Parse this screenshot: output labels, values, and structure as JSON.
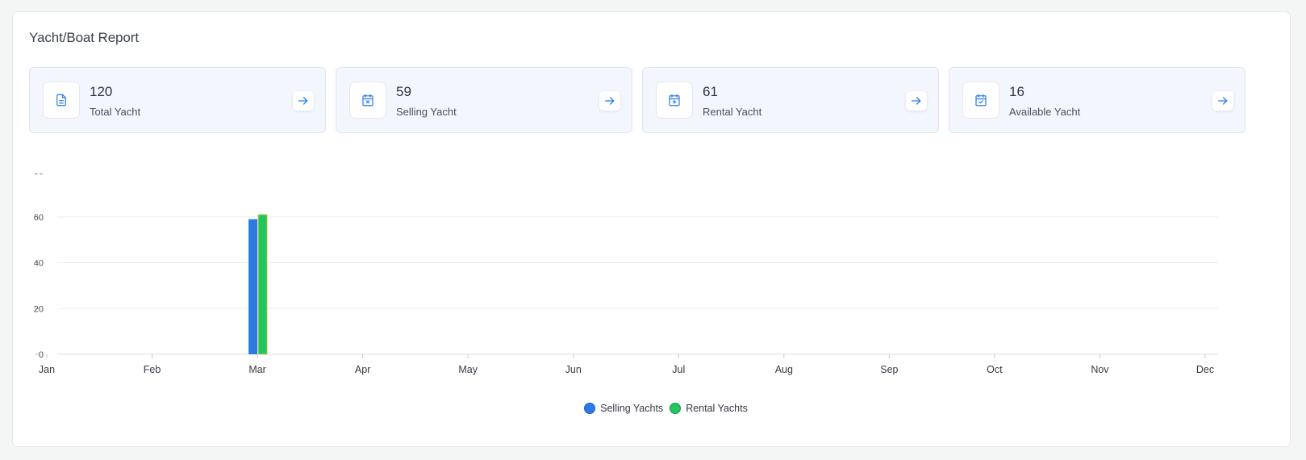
{
  "report": {
    "title": "Yacht/Boat Report"
  },
  "stats": [
    {
      "value": "120",
      "label": "Total Yacht",
      "icon": "document-icon"
    },
    {
      "value": "59",
      "label": "Selling Yacht",
      "icon": "calendar-x-icon"
    },
    {
      "value": "61",
      "label": "Rental Yacht",
      "icon": "calendar-plus-icon"
    },
    {
      "value": "16",
      "label": "Available Yacht",
      "icon": "calendar-check-icon"
    }
  ],
  "colors": {
    "accent": "#2c7be5",
    "selling": "#2c7be5",
    "rental": "#22c55e"
  },
  "chart_data": {
    "type": "bar",
    "categories": [
      "Jan",
      "Feb",
      "Mar",
      "Apr",
      "May",
      "Jun",
      "Jul",
      "Aug",
      "Sep",
      "Oct",
      "Nov",
      "Dec"
    ],
    "series": [
      {
        "name": "Selling Yachts",
        "values": [
          0,
          0,
          59,
          0,
          0,
          0,
          0,
          0,
          0,
          0,
          0,
          0
        ]
      },
      {
        "name": "Rental Yachts",
        "values": [
          0,
          0,
          61,
          0,
          0,
          0,
          0,
          0,
          0,
          0,
          0,
          0
        ]
      }
    ],
    "ylim": [
      0,
      80
    ],
    "yticks": [
      0,
      20,
      40,
      60,
      80
    ],
    "grid": true,
    "legend": "bottom-center"
  }
}
